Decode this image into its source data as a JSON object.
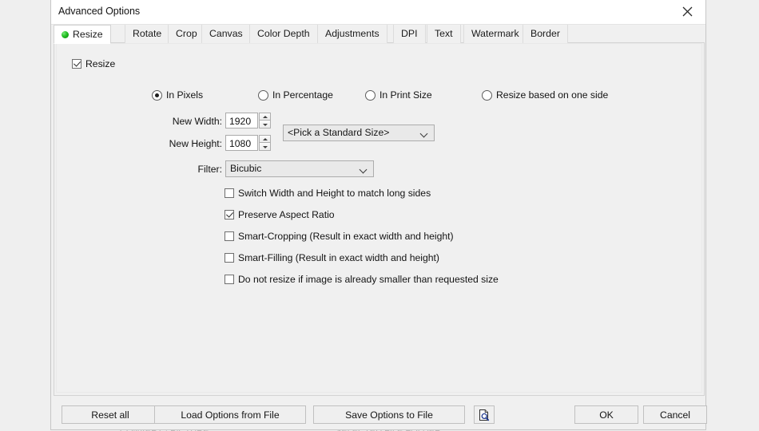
{
  "window": {
    "title": "Advanced Options",
    "close_icon": "close-icon"
  },
  "tabs": [
    {
      "label": "Resize",
      "active": true,
      "has_indicator": true,
      "indicator_color": "#22b422"
    },
    {
      "label": "Rotate",
      "active": false
    },
    {
      "label": "Crop",
      "active": false
    },
    {
      "label": "Canvas",
      "active": false
    },
    {
      "label": "Color Depth",
      "active": false
    },
    {
      "label": "Adjustments",
      "active": false
    },
    {
      "label": "DPI",
      "active": false
    },
    {
      "label": "Text",
      "active": false
    },
    {
      "label": "Watermark",
      "active": false
    },
    {
      "label": "Border",
      "active": false
    }
  ],
  "resize_panel": {
    "enable_checkbox": {
      "label": "Resize",
      "checked": true
    },
    "mode_radios": [
      {
        "label": "In Pixels",
        "selected": true
      },
      {
        "label": "In Percentage",
        "selected": false
      },
      {
        "label": "In Print Size",
        "selected": false
      },
      {
        "label": "Resize based on one side",
        "selected": false
      }
    ],
    "new_width": {
      "label": "New Width:",
      "value": "1920"
    },
    "new_height": {
      "label": "New Height:",
      "value": "1080"
    },
    "standard_size": {
      "value": "<Pick a Standard Size>"
    },
    "filter": {
      "label": "Filter:",
      "value": "Bicubic"
    },
    "options": [
      {
        "label": "Switch Width and Height to match long sides",
        "checked": false
      },
      {
        "label": "Preserve Aspect Ratio",
        "checked": true
      },
      {
        "label": "Smart-Cropping (Result in exact width and height)",
        "checked": false
      },
      {
        "label": "Smart-Filling (Result in exact width and height)",
        "checked": false
      },
      {
        "label": "Do not resize if image is already smaller than requested size",
        "checked": false
      }
    ]
  },
  "footer": {
    "reset_all": "Reset all",
    "load_options": "Load Options from File",
    "save_options": "Save Options to File",
    "preview_icon": "document-preview-icon",
    "ok": "OK",
    "cancel": "Cancel"
  },
  "background": {
    "ghost_left": "CONVERT · PICTURE",
    "ghost_right": "SELECTED FILE FOLDER"
  }
}
